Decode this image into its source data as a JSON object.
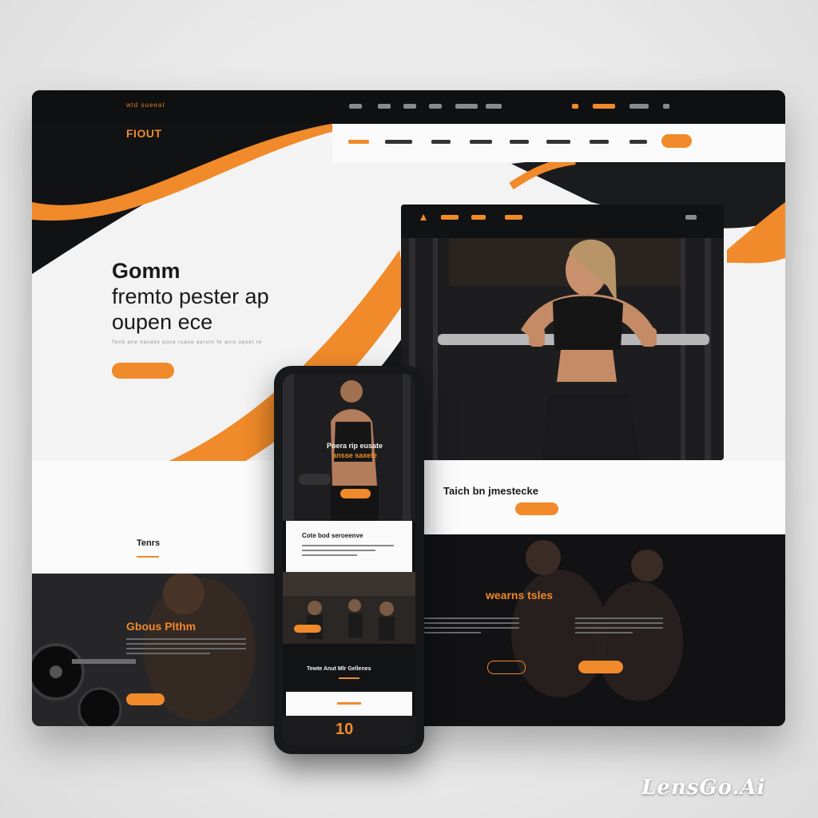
{
  "desktop": {
    "brand_small": "wtd sueeat",
    "logo": "FIOUT",
    "hero": {
      "title_line1": "Gomm",
      "title_line2": "fremto pester ap",
      "title_line3": "oupen ece",
      "text": "Tenh ane nasdes pusa ruane aeruin fe anis opsel re"
    },
    "tablet_banner_title": "Taich bn jmestecke",
    "section_left_title": "Tenrs",
    "gallery_left_title": "Gbous Plthm",
    "gallery_right_title": "wearns tsles"
  },
  "phone": {
    "hero_title_1": "Poera rip eusate",
    "hero_title_2": "ansse saxele",
    "card_title": "Cote bod seroeenve",
    "dark_caption": "Tewte Anut Mlr Gellenes",
    "bottom_badge": "10"
  },
  "watermark": "LensGo.Ai",
  "colors": {
    "accent": "#f08a2a",
    "dark": "#111214",
    "light": "#fafafa"
  }
}
